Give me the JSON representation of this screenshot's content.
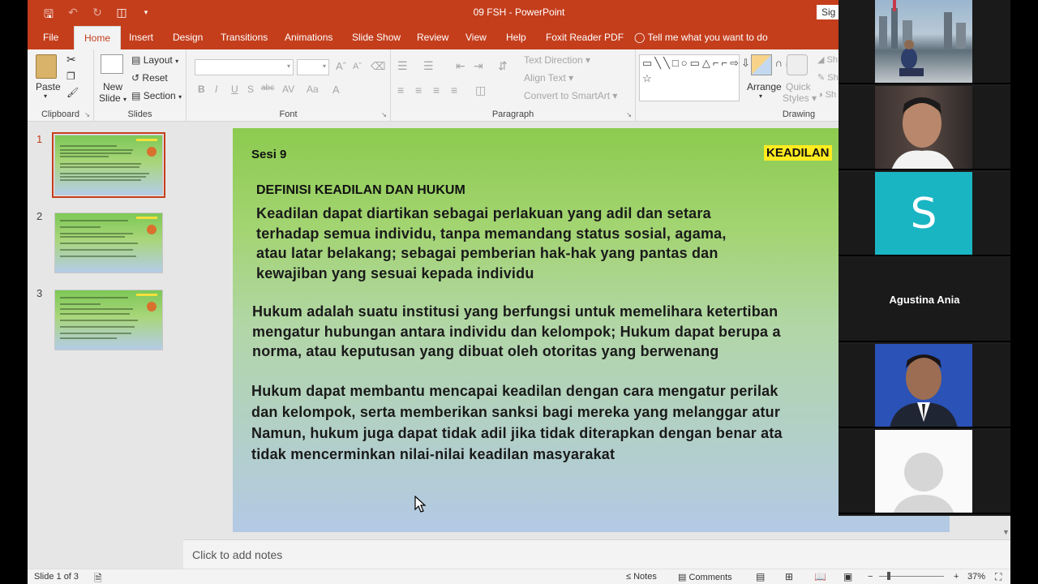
{
  "window": {
    "document": "09 FSH",
    "separator": "-",
    "app": "PowerPoint",
    "signin": "Sig"
  },
  "tabs": [
    "File",
    "Home",
    "Insert",
    "Design",
    "Transitions",
    "Animations",
    "Slide Show",
    "Review",
    "View",
    "Help",
    "Foxit Reader PDF"
  ],
  "tellme": "Tell me what you want to do",
  "ribbon": {
    "clipboard": {
      "paste": "Paste",
      "label": "Clipboard"
    },
    "slides": {
      "new_slide_1": "New",
      "new_slide_2": "Slide",
      "layout": "Layout",
      "reset": "Reset",
      "section": "Section",
      "label": "Slides"
    },
    "font": {
      "label": "Font",
      "bold": "B",
      "italic": "I",
      "underline": "U",
      "shadow": "S",
      "strike": "abc"
    },
    "paragraph": {
      "label": "Paragraph",
      "text_direction": "Text Direction",
      "align_text": "Align Text",
      "convert_smartart": "Convert to SmartArt"
    },
    "drawing": {
      "label": "Drawing",
      "arrange": "Arrange",
      "quick_styles_1": "Quick",
      "quick_styles_2": "Styles"
    }
  },
  "thumbs": [
    {
      "num": "1"
    },
    {
      "num": "2"
    },
    {
      "num": "3"
    }
  ],
  "slide": {
    "session": "Sesi 9",
    "badge": "KEADILAN",
    "heading": "DEFINISI KEADILAN DAN HUKUM",
    "p1": [
      "Keadilan dapat diartikan sebagai perlakuan yang adil dan setara",
      "terhadap semua individu, tanpa memandang status sosial, agama,",
      "atau latar belakang; sebagai pemberian hak-hak yang pantas dan",
      "kewajiban yang sesuai kepada individu"
    ],
    "p2": [
      "Hukum adalah suatu institusi yang berfungsi untuk memelihara ketertiban",
      "mengatur hubungan antara individu dan kelompok; Hukum dapat berupa a",
      "norma, atau keputusan yang dibuat oleh otoritas yang berwenang"
    ],
    "p3": [
      "Hukum dapat membantu mencapai keadilan dengan cara mengatur perilak",
      "dan kelompok, serta memberikan sanksi bagi mereka yang melanggar atur",
      "Namun, hukum juga dapat tidak adil jika tidak diterapkan dengan benar ata",
      "tidak mencerminkan nilai-nilai keadilan masyarakat"
    ]
  },
  "notes_placeholder": "Click to add notes",
  "status": {
    "slide_info": "Slide 1 of 3",
    "notes": "Notes",
    "comments": "Comments",
    "zoom": "37%"
  },
  "participants": [
    {
      "name": "",
      "kind": "photo-city"
    },
    {
      "name": "",
      "kind": "photo-man"
    },
    {
      "name": "",
      "kind": "initial",
      "initial": "S"
    },
    {
      "name": "Agustina Ania",
      "kind": "name-only"
    },
    {
      "name": "",
      "kind": "photo-formal"
    },
    {
      "name": "",
      "kind": "avatar-placeholder"
    }
  ],
  "colors": {
    "accent": "#c43e1c",
    "badge": "#ffeb1f",
    "initial_tile": "#1ab5c3"
  }
}
